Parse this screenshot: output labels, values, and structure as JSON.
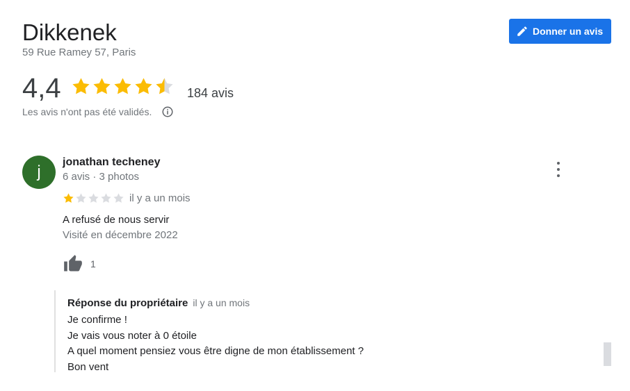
{
  "place": {
    "name": "Dikkenek",
    "address": "59 Rue Ramey 57, Paris",
    "write_review_label": "Donner un avis",
    "rating": "4,4",
    "rating_value": 4.4,
    "review_count": "184 avis",
    "not_validated_text": "Les avis n'ont pas été validés."
  },
  "review": {
    "avatar_letter": "j",
    "avatar_color": "#2e6f2a",
    "author": "jonathan techeney",
    "author_meta": "6 avis · 3 photos",
    "stars": 1,
    "time": "il y a un mois",
    "text": "A refusé de nous servir",
    "visited": "Visité en décembre 2022",
    "likes": "1"
  },
  "owner_response": {
    "label": "Réponse du propriétaire",
    "time": "il y a un mois",
    "lines": [
      "Je confirme !",
      "Je vais vous noter à 0 étoile",
      "A quel moment pensiez vous être digne de mon établissement ?",
      "Bon vent"
    ]
  },
  "colors": {
    "accent": "#1a73e8",
    "star": "#fbbc04",
    "star_empty": "#dadce0"
  }
}
